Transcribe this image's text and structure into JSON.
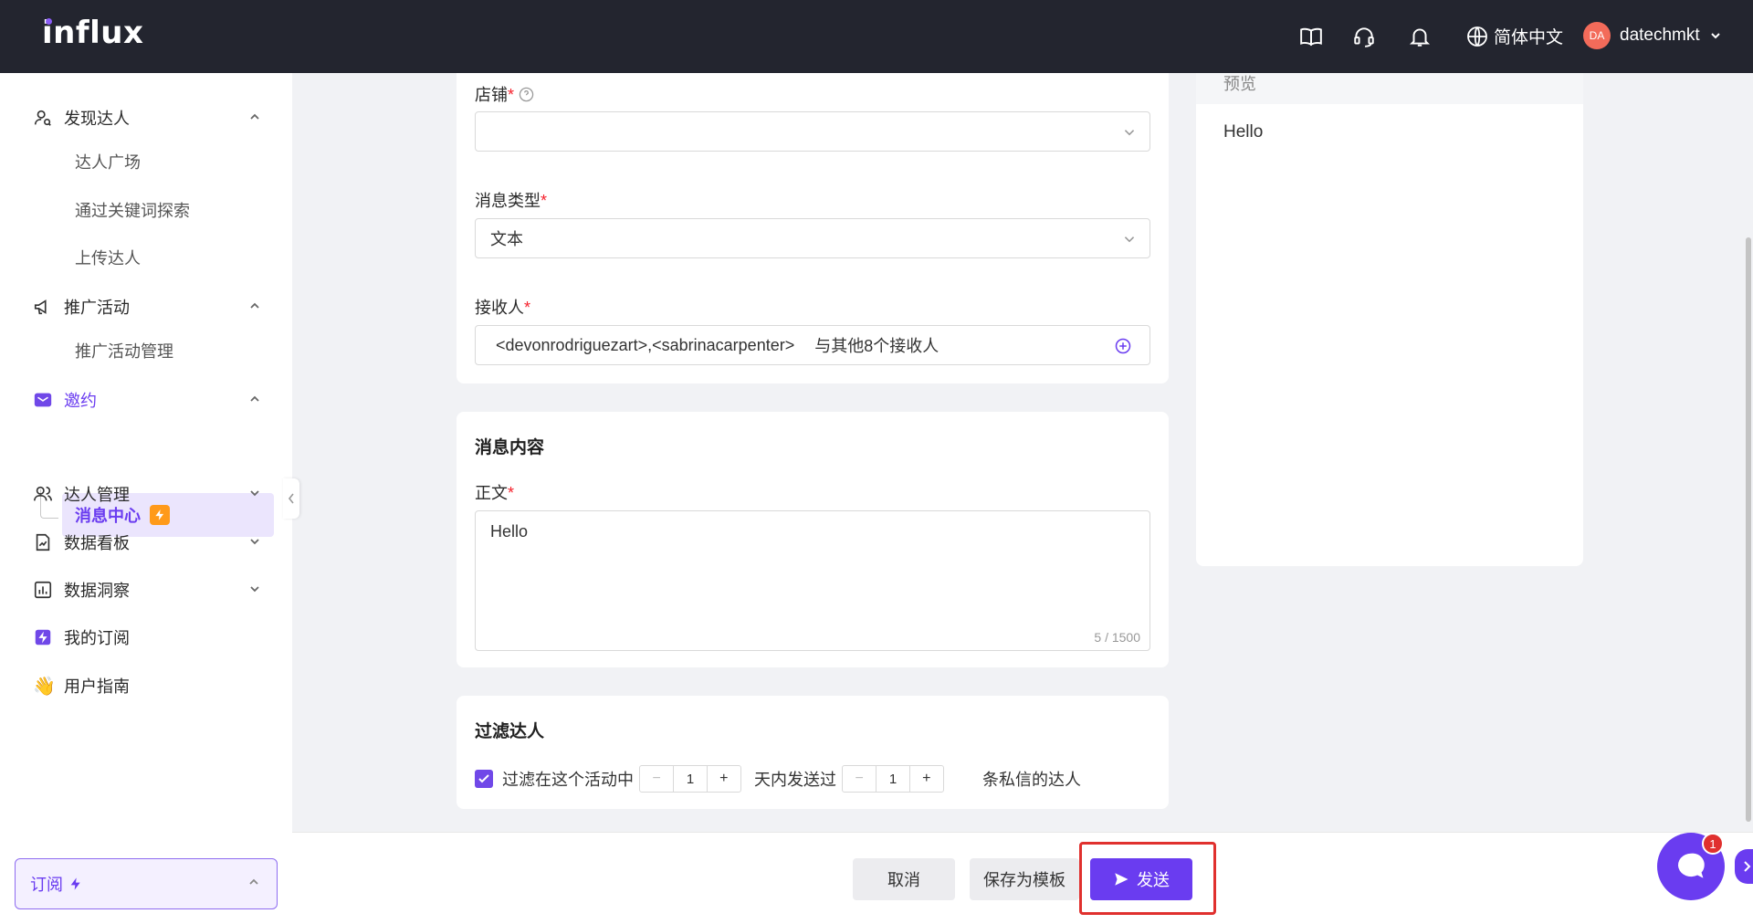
{
  "app": {
    "logo": "influx"
  },
  "topbar": {
    "language": "简体中文",
    "user_initials": "DA",
    "username": "datechmkt"
  },
  "sidebar": {
    "discover": {
      "label": "发现达人",
      "items": [
        "达人广场",
        "通过关键词探索",
        "上传达人"
      ]
    },
    "campaign": {
      "label": "推广活动",
      "items": [
        "推广活动管理"
      ]
    },
    "invite": {
      "label": "邀约",
      "active_item": "消息中心"
    },
    "creator_mgmt": "达人管理",
    "dashboard": "数据看板",
    "insights": "数据洞察",
    "subscription": "我的订阅",
    "guide": "用户指南",
    "subscribe_box": "订阅"
  },
  "form": {
    "shop_label": "店铺",
    "shop_value": "",
    "msg_type_label": "消息类型",
    "msg_type_value": "文本",
    "recipients_label": "接收人",
    "recipients_value": "<devonrodriguezart>,<sabrinacarpenter>",
    "recipients_extra": "与其他8个接收人"
  },
  "content": {
    "title": "消息内容",
    "body_label": "正文",
    "body_value": "Hello",
    "counter": "5 / 1500"
  },
  "filter": {
    "title": "过滤达人",
    "text1": "过滤在这个活动中",
    "days_value": "1",
    "text2": "天内发送过",
    "count_value": "1",
    "text3": "条私信的达人"
  },
  "preview": {
    "header": "预览",
    "text": "Hello"
  },
  "footer": {
    "cancel": "取消",
    "save_template": "保存为模板",
    "send": "发送"
  },
  "chat": {
    "badge": "1"
  },
  "colors": {
    "primary": "#6a3cf0",
    "topbar": "#23252f",
    "highlight": "#e0302e"
  }
}
